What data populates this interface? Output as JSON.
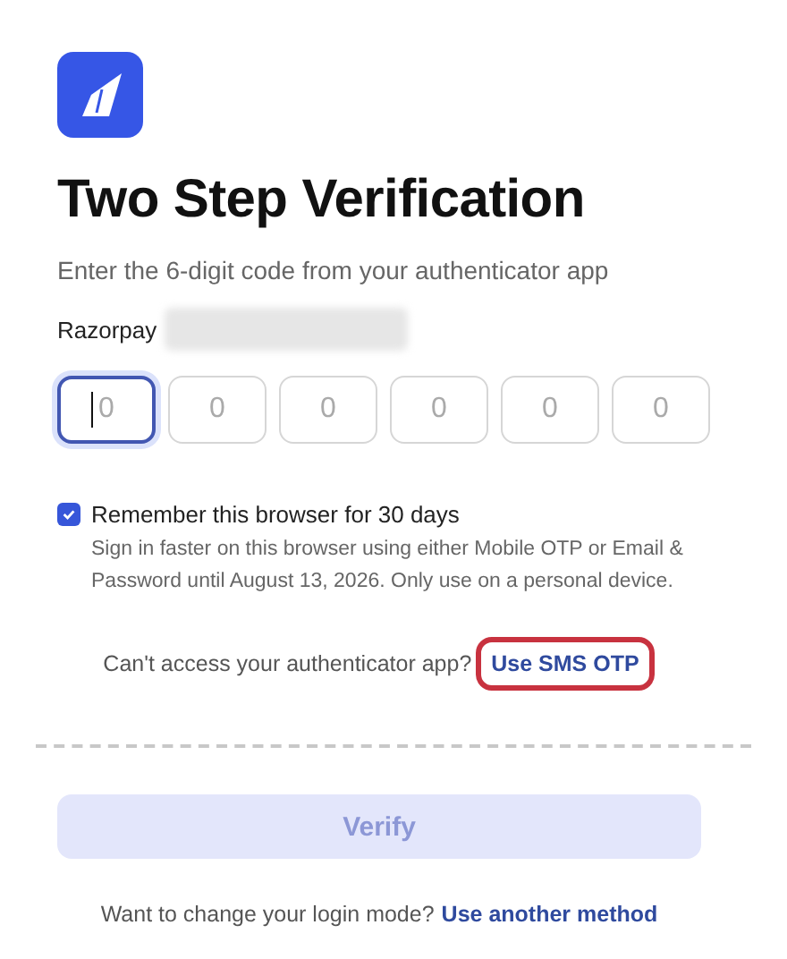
{
  "title": "Two Step Verification",
  "subtitle": "Enter the 6-digit code from your authenticator app",
  "account": {
    "label": "Razorpay",
    "redacted": true
  },
  "otp_fields": [
    {
      "placeholder": "0",
      "focused": true
    },
    {
      "placeholder": "0",
      "focused": false
    },
    {
      "placeholder": "0",
      "focused": false
    },
    {
      "placeholder": "0",
      "focused": false
    },
    {
      "placeholder": "0",
      "focused": false
    },
    {
      "placeholder": "0",
      "focused": false
    }
  ],
  "remember": {
    "label": "Remember this browser for 30 days",
    "checked": true,
    "description": "Sign in faster on this browser using either Mobile OTP or Email & Password until August 13, 2026. Only use on a personal device."
  },
  "alternate": {
    "prompt": "Can't access your authenticator app?",
    "link": "Use SMS OTP",
    "highlighted": true
  },
  "verify_button": {
    "label": "Verify",
    "disabled": true
  },
  "footer": {
    "prompt": "Want to change your login mode?",
    "link": "Use another method"
  }
}
